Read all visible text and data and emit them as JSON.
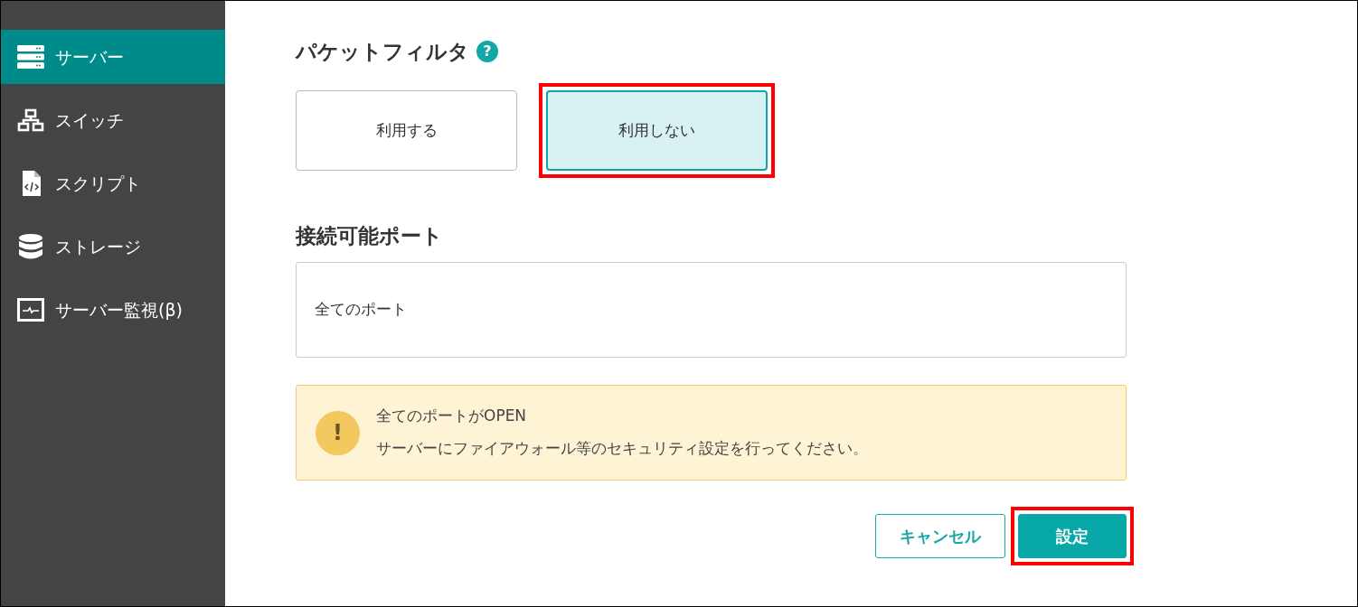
{
  "sidebar": {
    "items": [
      {
        "kind": "server",
        "label": "サーバー",
        "selected": true
      },
      {
        "kind": "switch",
        "label": "スイッチ",
        "selected": false
      },
      {
        "kind": "script",
        "label": "スクリプト",
        "selected": false
      },
      {
        "kind": "storage",
        "label": "ストレージ",
        "selected": false
      },
      {
        "kind": "monitor",
        "label": "サーバー監視(β)",
        "selected": false
      }
    ]
  },
  "packet_filter": {
    "title": "パケットフィルタ",
    "help": "?",
    "options": [
      {
        "label": "利用する",
        "selected": false,
        "highlighted": false
      },
      {
        "label": "利用しない",
        "selected": true,
        "highlighted": true
      }
    ]
  },
  "ports": {
    "title": "接続可能ポート",
    "value": "全てのポート"
  },
  "alert": {
    "icon": "!",
    "title": "全てのポートがOPEN",
    "message": "サーバーにファイアウォール等のセキュリティ設定を行ってください。"
  },
  "buttons": [
    {
      "kind": "secondary",
      "label": "キャンセル",
      "highlighted": false
    },
    {
      "kind": "primary",
      "label": "設定",
      "highlighted": true
    }
  ]
}
